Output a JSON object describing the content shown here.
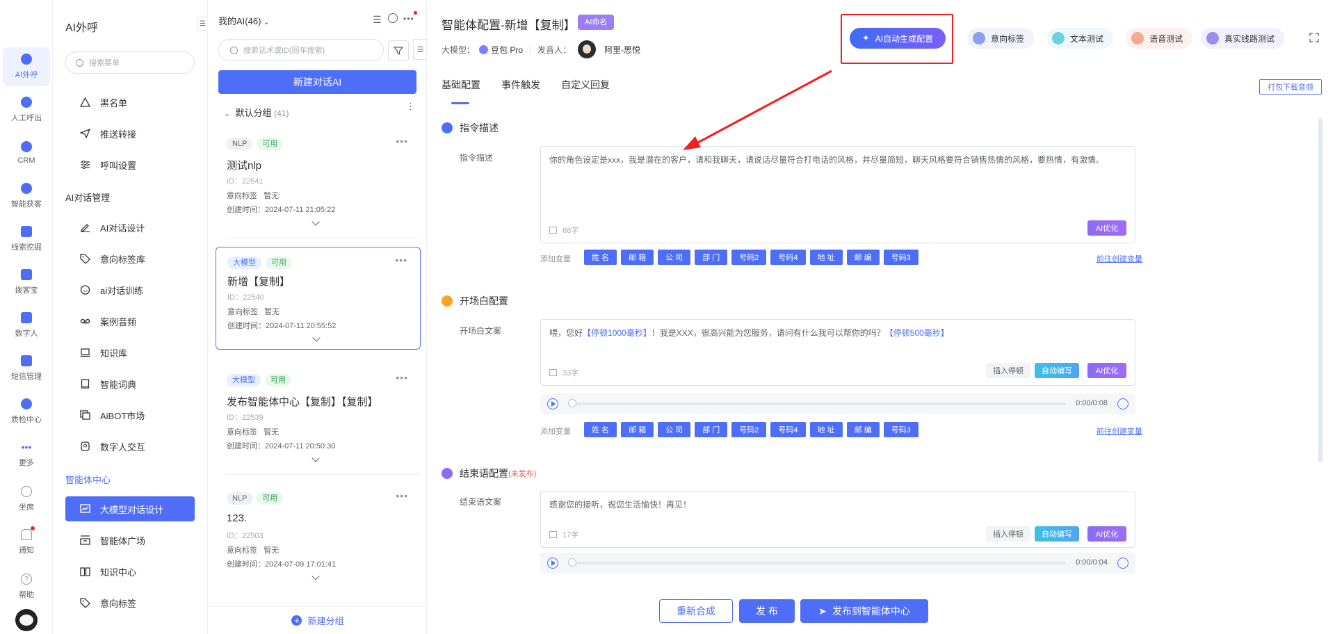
{
  "rail": {
    "items": [
      {
        "label": "AI外呼",
        "icon": "robot-icon"
      },
      {
        "label": "人工呼出",
        "icon": "phone-icon"
      },
      {
        "label": "CRM",
        "icon": "crm-icon"
      },
      {
        "label": "智能获客",
        "icon": "target-icon"
      },
      {
        "label": "线索挖掘",
        "icon": "mining-icon"
      },
      {
        "label": "拨客宝",
        "icon": "dialer-icon"
      },
      {
        "label": "数字人",
        "icon": "digital-human-icon"
      },
      {
        "label": "短信管理",
        "icon": "sms-icon"
      },
      {
        "label": "质检中心",
        "icon": "quality-icon"
      },
      {
        "label": "更多",
        "icon": "more-icon"
      },
      {
        "label": "坐席",
        "icon": "headset-icon"
      },
      {
        "label": "通知",
        "icon": "bell-icon"
      },
      {
        "label": "帮助",
        "icon": "help-icon"
      }
    ]
  },
  "menu": {
    "title": "AI外呼",
    "search_placeholder": "搜索菜单",
    "items_top": [
      {
        "label": "黑名单",
        "icon": "warning-icon"
      },
      {
        "label": "推送转接",
        "icon": "send-icon"
      },
      {
        "label": "呼叫设置",
        "icon": "sliders-icon"
      }
    ],
    "group1": "AI对话管理",
    "items_mid": [
      {
        "label": "AI对话设计",
        "icon": "pen-icon"
      },
      {
        "label": "意向标签库",
        "icon": "tag-icon"
      },
      {
        "label": "ai对话训练",
        "icon": "chat-icon"
      },
      {
        "label": "案例音频",
        "icon": "tape-icon"
      },
      {
        "label": "知识库",
        "icon": "laptop-icon"
      },
      {
        "label": "智能词典",
        "icon": "book-icon"
      },
      {
        "label": "AiBOT市场",
        "icon": "window-icon"
      },
      {
        "label": "数字人交互",
        "icon": "person-icon"
      }
    ],
    "group2": "智能体中心",
    "items_bottom": [
      {
        "label": "大模型对话设计",
        "icon": "chart-icon",
        "active": true
      },
      {
        "label": "智能体广场",
        "icon": "store-icon"
      },
      {
        "label": "知识中心",
        "icon": "open-book-icon"
      },
      {
        "label": "意向标签",
        "icon": "tag-icon"
      }
    ]
  },
  "list": {
    "header": "我的AI(46)",
    "search_placeholder": "搜索话术或ID(回车搜索)",
    "new_button": "新建对话AI",
    "group_name": "默认分组",
    "group_count": "(41)",
    "intent_label": "意向标签",
    "created_label": "创建时间：",
    "cards": [
      {
        "type": "NLP",
        "status": "可用",
        "title": "测试nlp",
        "id": "ID：22541",
        "intent": "暂无",
        "created": "2024-07-11 21:05:22"
      },
      {
        "type": "大模型",
        "status": "可用",
        "title": "新增【复制】",
        "id": "ID：22540",
        "intent": "暂无",
        "created": "2024-07-11 20:55:52"
      },
      {
        "type": "大模型",
        "status": "可用",
        "title": "发布智能体中心【复制】【复制】",
        "id": "ID：22539",
        "intent": "暂无",
        "created": "2024-07-11 20:50:30"
      },
      {
        "type": "NLP",
        "status": "可用",
        "title": "123.",
        "id": "ID：22503",
        "intent": "暂无",
        "created": "2024-07-09 17:01:41"
      }
    ],
    "new_group": "新建分组"
  },
  "main": {
    "title": "智能体配置-新增【复制】",
    "ai_name_badge": "AI命名",
    "model_label": "大模型：",
    "model_value": "豆包 Pro",
    "speaker_label": "发音人：",
    "speaker_value": "阿里-思悦",
    "ai_generate": "AI自动生成配置",
    "tools": [
      "意向标签",
      "文本测试",
      "语音测试",
      "真实线路测试"
    ],
    "tabs": [
      "基础配置",
      "事件触发",
      "自定义回复"
    ],
    "download_button": "打包下载音频",
    "instruction": {
      "section": "指令描述",
      "label": "指令描述",
      "text": "你的角色设定是xxx，我是潜在的客户，请和我聊天，请说话尽量符合打电话的风格，并尽量简短，聊天风格要符合销售热情的风格，要热情，有激情。",
      "count": "68字",
      "optimize": "AI优化"
    },
    "variables_label": "添加变量",
    "variables": [
      "姓 名",
      "邮 箱",
      "公 司",
      "部 门",
      "号码2",
      "号码4",
      "地 址",
      "邮 编",
      "号码3"
    ],
    "variables_link": "前往创建变量",
    "opening": {
      "section": "开场白配置",
      "label": "开场白文案",
      "text_a": "喂，您好",
      "pause_a": "【停顿1000毫秒】",
      "text_b": "！我是XXX，很高兴能为您服务，请问有什么我可以帮你的吗？",
      "pause_b": "【停顿500毫秒】",
      "count": "33字",
      "audio_time": "0:00/0:08"
    },
    "closing": {
      "section": "结束语配置",
      "unpublished": "(未发布)",
      "label": "结束语文案",
      "text": "感谢您的接听，祝您生活愉快！再见！",
      "count": "17字",
      "audio_time": "0:00/0:04"
    },
    "insert_pause": "插入停顿",
    "auto_write": "自动编写",
    "ai_optimize": "AI优化",
    "footer": {
      "resynth": "重新合成",
      "publish": "发 布",
      "publish_center": "发布到智能体中心"
    }
  },
  "colors": {
    "accent": "#4f6ef7",
    "annotation": "#f02020"
  }
}
